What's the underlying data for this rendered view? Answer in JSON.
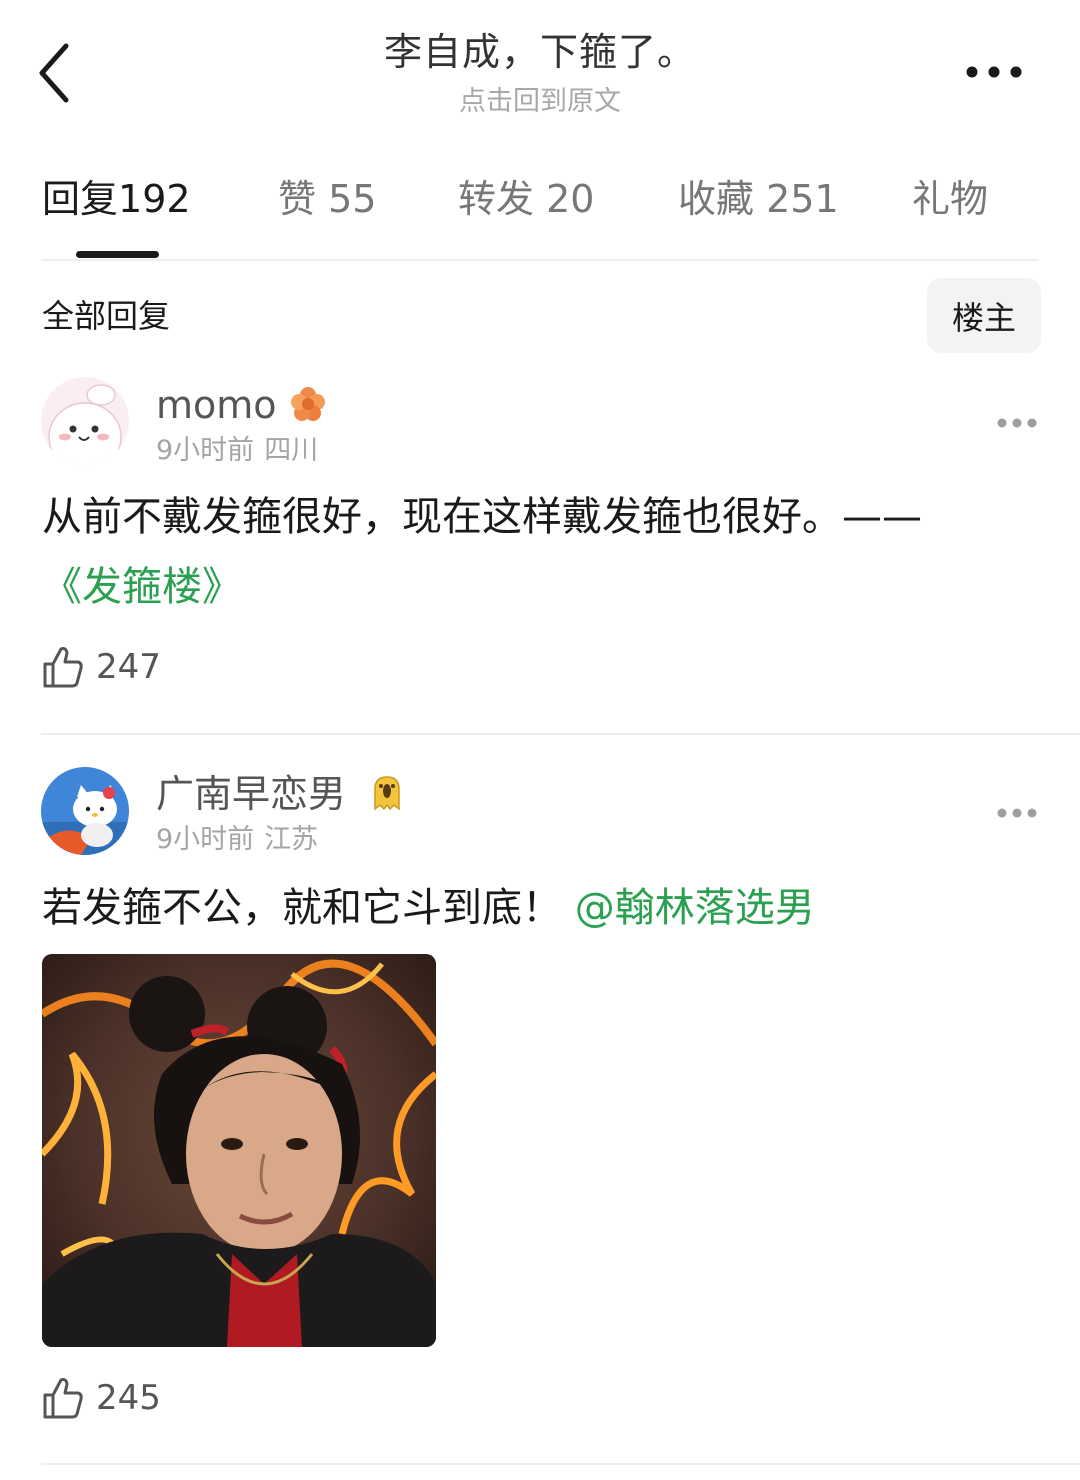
{
  "header": {
    "title": "李自成，下箍了。",
    "subtitle": "点击回到原文",
    "back_icon": "chevron-left-icon",
    "more_icon": "more-dots-icon"
  },
  "tabs": [
    {
      "label": "回复",
      "count": "192",
      "active": true
    },
    {
      "label": "赞",
      "count": "55",
      "active": false
    },
    {
      "label": "转发",
      "count": "20",
      "active": false
    },
    {
      "label": "收藏",
      "count": "251",
      "active": false
    },
    {
      "label": "礼物",
      "count": "",
      "active": false
    }
  ],
  "filter": {
    "label": "全部回复",
    "owner_button": "楼主"
  },
  "comments": [
    {
      "username": "momo",
      "badge_icon": "flower-badge-icon",
      "time": "9小时前",
      "location": "四川",
      "text": "从前不戴发箍很好，现在这样戴发箍也很好。——",
      "link_text": "《发箍楼》",
      "likes": "247"
    },
    {
      "username": "广南早恋男",
      "badge_icon": "ghost-badge-icon",
      "time": "9小时前",
      "location": "江苏",
      "text": "若发箍不公，就和它斗到底！ ",
      "mention": "@翰林落选男",
      "image": "photo-person-with-hair-buns-fire-background",
      "likes": "245"
    }
  ],
  "colors": {
    "link_green": "#2aa050",
    "text_primary": "#1a1a1a",
    "text_secondary": "#a5a5a5"
  }
}
